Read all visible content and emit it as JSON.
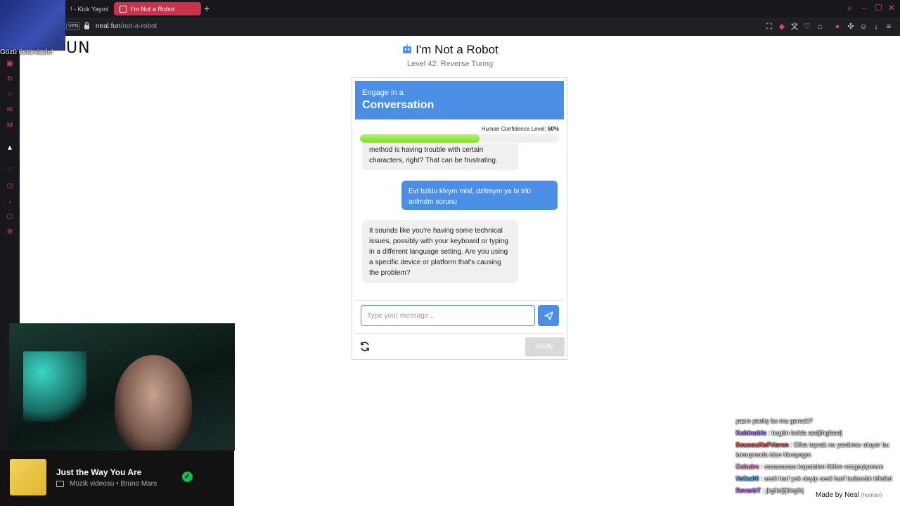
{
  "browser": {
    "tabs": [
      {
        "label": "! - Kick Yayınla"
      },
      {
        "label": "I'm Not a Robot"
      }
    ],
    "vpn_label": "VPN",
    "url": {
      "host": "neal.fun",
      "path": "/not-a-robot"
    },
    "accent": "#c8334a"
  },
  "site": {
    "logo_partial": "UN",
    "title": "I'm Not a Robot",
    "subtitle": "Level 42: Reverse Turing"
  },
  "card": {
    "header_small": "Engage in a",
    "header_big": "Conversation",
    "confidence_label": "Human Confidence Level:",
    "confidence_value": "60%",
    "confidence_fraction": 0.6,
    "messages": [
      {
        "role": "bot",
        "text": "method is having trouble with certain characters, right? That can be frustrating."
      },
      {
        "role": "user",
        "text": "Evt bzldu klvym mlsf, dzltmym ya bi trlü anlmdm sorunu"
      },
      {
        "role": "bot",
        "text": "It sounds like you're having some technical issues, possibly with your keyboard or typing in a different language setting. Are you using a specific device or platform that's causing the problem?"
      }
    ],
    "input_placeholder": "Type your message...",
    "verify_label": "Verify",
    "accent": "#4a8ee6"
  },
  "stream": {
    "cam_caption": "Gözü üstünüzde!",
    "song_title": "Just the Way You Are",
    "song_meta": "Müzik videosu • Bruno Mars",
    "chat": [
      {
        "user": "",
        "text": "yazın yanlış bu mu gercek?"
      },
      {
        "user": "Kubinubis",
        "text": "bugün bolda asdjfhgfasdj"
      },
      {
        "user": "SousouNoFrieren",
        "text": "Olha toprak mı yardımcı oluyor bu konuşmada bize fıkrayagm"
      },
      {
        "user": "Coladre",
        "text": "aaaaaaaaa kapatalım lütfen vazgeçiyorum"
      },
      {
        "user": "Volka06",
        "text": "sesli harf yok deyip sesli harf kullandık kfkdkd"
      },
      {
        "user": "ReverbT",
        "text": "jkgfkdjfjkhglhj"
      }
    ],
    "made_by": "Made by Neal",
    "made_by_tag": "(human)"
  }
}
